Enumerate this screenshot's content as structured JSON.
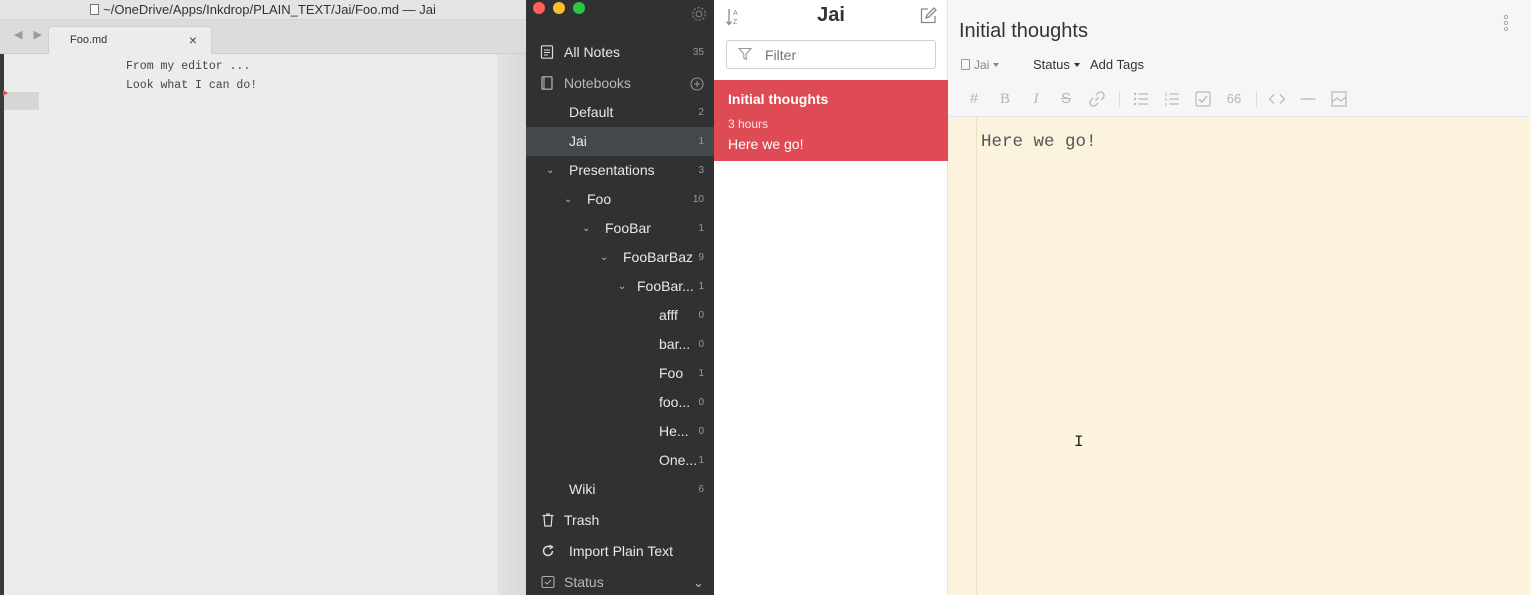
{
  "text_editor": {
    "window_title": "~/OneDrive/Apps/Inkdrop/PLAIN_TEXT/Jai/Foo.md — Jai",
    "tab_label": "Foo.md",
    "tab_close": "×",
    "nav_arrows": "◀ ▶",
    "lines": [
      "From my editor ...",
      "Look what I can do!"
    ]
  },
  "sidebar": {
    "all_notes": {
      "label": "All Notes",
      "count": "35"
    },
    "notebooks_label": "Notebooks",
    "notebooks": [
      {
        "label": "Default",
        "count": "2",
        "active": false
      },
      {
        "label": "Jai",
        "count": "1",
        "active": true
      },
      {
        "label": "Presentations",
        "count": "3",
        "expanded": true
      },
      {
        "label": "Foo",
        "count": "10",
        "expanded": true
      },
      {
        "label": "FooBar",
        "count": "1",
        "expanded": true
      },
      {
        "label": "FooBarBaz",
        "count": "9",
        "expanded": true
      },
      {
        "label": "FooBar...",
        "count": "1",
        "expanded": true
      },
      {
        "label": "afff",
        "count": "0"
      },
      {
        "label": "bar...",
        "count": "0"
      },
      {
        "label": "Foo",
        "count": "1"
      },
      {
        "label": "foo...",
        "count": "0"
      },
      {
        "label": "He...",
        "count": "0"
      },
      {
        "label": "One...",
        "count": "1"
      },
      {
        "label": "Wiki",
        "count": "6"
      }
    ],
    "trash_label": "Trash",
    "import_label": "Import Plain Text",
    "status_label": "Status"
  },
  "note_list": {
    "title": "Jai",
    "filter_placeholder": "Filter",
    "notes": [
      {
        "title": "Initial thoughts",
        "time": "3 hours",
        "snippet": "Here we go!"
      }
    ]
  },
  "note_editor": {
    "title": "Initial thoughts",
    "notebook": "Jai",
    "status_label": "Status",
    "add_tags_label": "Add Tags",
    "toolbar": {
      "heading": "#",
      "bold": "B",
      "italic": "I",
      "strike": "S",
      "quote": "66"
    },
    "body": "Here we go!",
    "ibeam": "I"
  },
  "colors": {
    "accent": "#df4b55",
    "sidebar_bg": "#2f3133",
    "editor_bg": "#fbf3de"
  }
}
